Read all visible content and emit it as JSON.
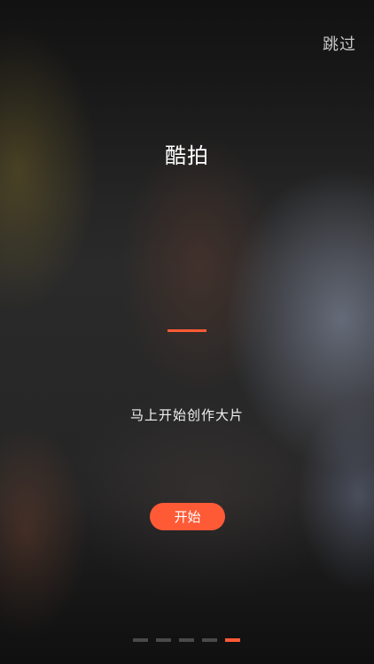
{
  "header": {
    "skip_label": "跳过"
  },
  "intro": {
    "title": "酷拍",
    "subtitle": "马上开始创作大片",
    "start_label": "开始"
  },
  "pager": {
    "total": 5,
    "active_index": 4
  },
  "colors": {
    "accent": "#ff5a36",
    "dot_inactive": "#4a4a4a",
    "background": "#262626"
  }
}
